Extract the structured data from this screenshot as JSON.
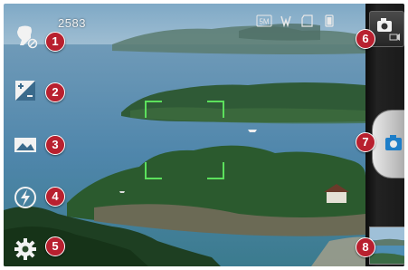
{
  "shot_count": "2583",
  "callouts": {
    "c1": "1",
    "c2": "2",
    "c3": "3",
    "c4": "4",
    "c5": "5",
    "c6": "6",
    "c7": "7",
    "c8": "8"
  },
  "status_icons": [
    "resolution-5m-icon",
    "white-balance-auto-icon",
    "memory-card-icon",
    "battery-icon"
  ],
  "left_controls": [
    "swap-lens-disabled-icon",
    "brightness-icon",
    "scene-mode-icon",
    "flash-auto-icon",
    "settings-icon"
  ],
  "right_controls": [
    "camera-video-mode-icon",
    "shutter-camera-icon",
    "gallery-thumbnail"
  ],
  "colors": {
    "callout_red": "#b8202f",
    "focus_green": "#5ce05c",
    "panel_dark": "#1a1a1a"
  }
}
